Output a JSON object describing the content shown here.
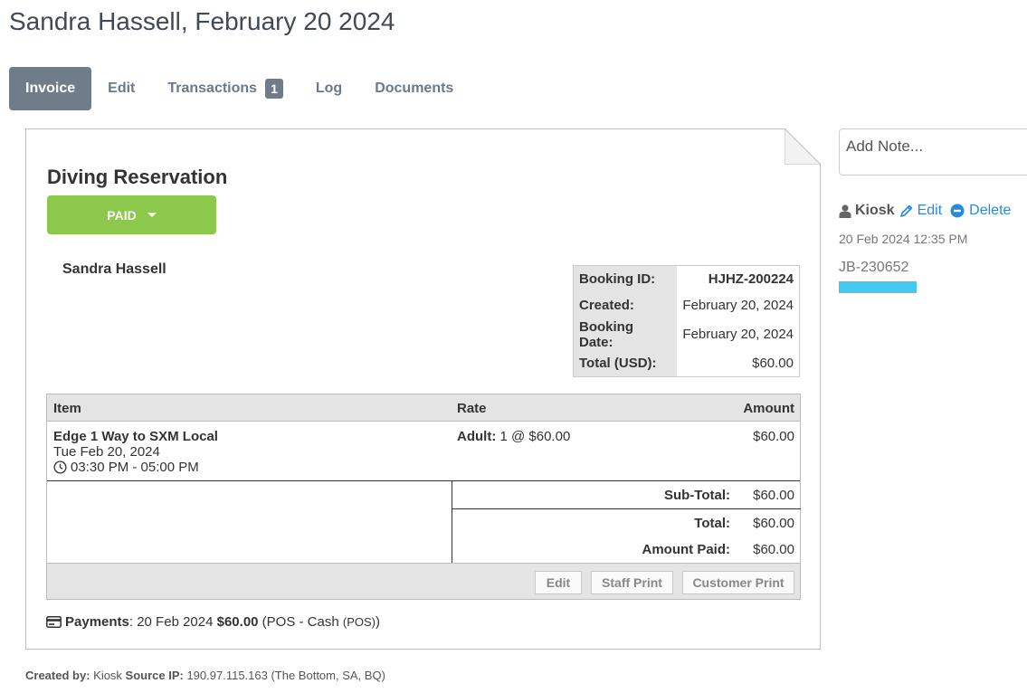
{
  "page": {
    "title": "Sandra Hassell, February 20 2024"
  },
  "tabs": [
    {
      "label": "Invoice"
    },
    {
      "label": "Edit"
    },
    {
      "label": "Transactions",
      "badge": "1"
    },
    {
      "label": "Log"
    },
    {
      "label": "Documents"
    }
  ],
  "invoice": {
    "title": "Diving Reservation",
    "status_label": "PAID",
    "customer_name": "Sandra Hassell",
    "booking": [
      {
        "key": "Booking ID:",
        "value": "HJHZ-200224"
      },
      {
        "key": "Created:",
        "value": "February 20, 2024"
      },
      {
        "key": "Booking Date:",
        "value": "February 20, 2024"
      },
      {
        "key": "Total (USD):",
        "value": "$60.00"
      }
    ],
    "columns": {
      "item": "Item",
      "rate": "Rate",
      "amount": "Amount"
    },
    "line_item": {
      "name": "Edge 1 Way to SXM Local",
      "date": "Tue Feb 20, 2024",
      "time": "03:30 PM - 05:00 PM",
      "rate_label": "Adult:",
      "rate_value": "1 @ $60.00",
      "amount": "$60.00"
    },
    "totals": {
      "subtotal_label": "Sub-Total:",
      "subtotal": "$60.00",
      "total_label": "Total:",
      "total": "$60.00",
      "paid_label": "Amount Paid:",
      "paid": "$60.00"
    },
    "buttons": {
      "edit": "Edit",
      "staff_print": "Staff Print",
      "customer_print": "Customer Print"
    },
    "payments": {
      "label": "Payments",
      "date": ": 20 Feb 2024 ",
      "amount": "$60.00",
      "method": " (POS - Cash ",
      "method_small": "(POS)",
      "close": ")"
    }
  },
  "footer": {
    "created_by_label": "Created by:",
    "created_by": " Kiosk ",
    "source_ip_label": "Source IP:",
    "source_ip": " 190.97.115.163 (The Bottom, SA, BQ)"
  },
  "notes": {
    "placeholder": "Add Note...",
    "author": "Kiosk",
    "edit_label": "Edit",
    "delete_label": "Delete",
    "timestamp": "20 Feb 2024 12:35 PM",
    "text": "JB-230652",
    "highlight_color": "#45c8f0"
  },
  "colors": {
    "accent": "#2a8ad4",
    "paid": "#8cc84b",
    "tab_active": "#6f7d8b"
  }
}
